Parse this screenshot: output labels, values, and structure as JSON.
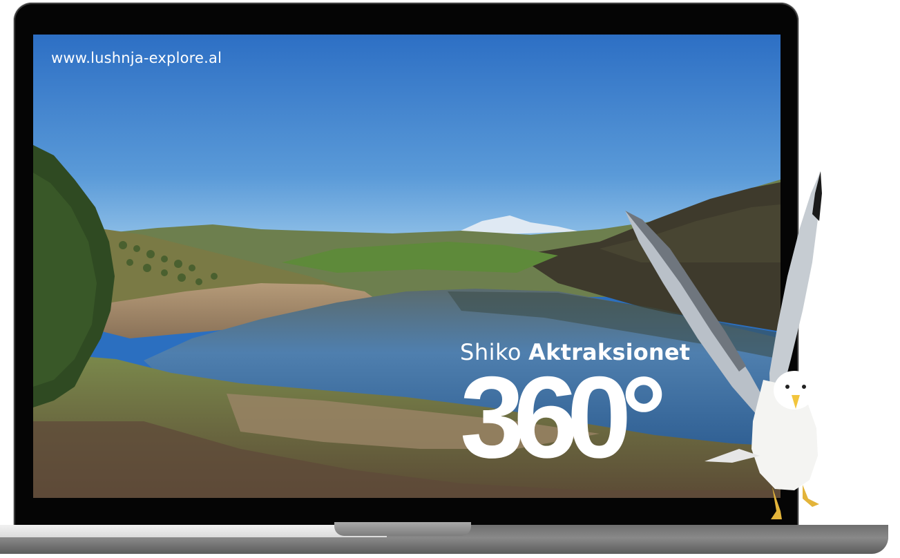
{
  "website_url": "www.lushnja-explore.al",
  "promo": {
    "prefix": "Shiko",
    "emphasis": "Aktraksionet",
    "big_text": "360°"
  },
  "icons": {
    "scene": "lake-landscape-photo",
    "bird": "seagull-image",
    "device": "laptop-mockup"
  },
  "colors": {
    "sky_top": "#2d6fc4",
    "sky_bottom": "#8ec3ea",
    "lake": "#3f74a8",
    "text": "#ffffff",
    "bezel": "#050505"
  }
}
